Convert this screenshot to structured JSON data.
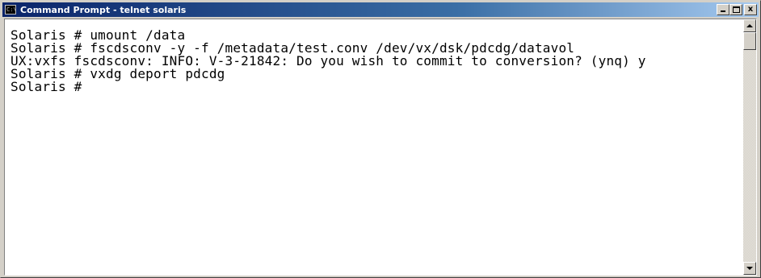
{
  "window": {
    "title": "Command Prompt - telnet solaris",
    "icon": "cmd-icon",
    "icon_text": "C:\\",
    "buttons": {
      "minimize_icon": "minimize-icon",
      "maximize_icon": "maximize-icon",
      "close_icon": "close-icon",
      "close_glyph": "x"
    }
  },
  "console": {
    "lines": [
      "Solaris # umount /data",
      "Solaris # fscdsconv -y -f /metadata/test.conv /dev/vx/dsk/pdcdg/datavol",
      "UX:vxfs fscdsconv: INFO: V-3-21842: Do you wish to commit to conversion? (ynq) y",
      "Solaris # vxdg deport pdcdg",
      "Solaris #"
    ],
    "scrollbar": {
      "up_icon": "scroll-up-arrow-icon",
      "down_icon": "scroll-down-arrow-icon"
    }
  },
  "colors": {
    "title_gradient_start": "#0a246a",
    "title_gradient_end": "#a6caf0",
    "console_background": "#ffffff",
    "console_text": "#000000",
    "chrome": "#d4d0c8"
  }
}
